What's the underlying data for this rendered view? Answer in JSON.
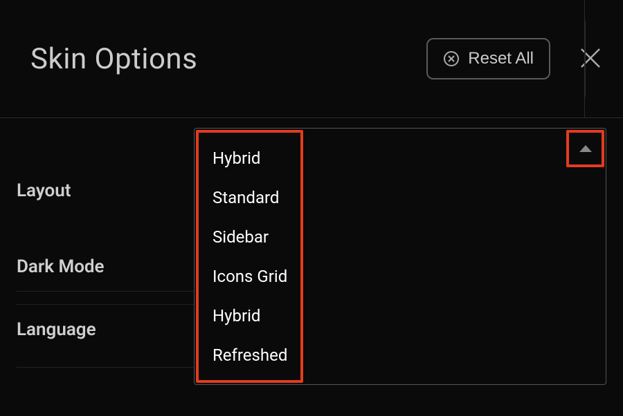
{
  "header": {
    "title": "Skin Options",
    "reset_label": "Reset All"
  },
  "rows": {
    "layout_label": "Layout",
    "darkmode_label": "Dark Mode",
    "language_label": "Language"
  },
  "dropdown": {
    "selected": "Hybrid",
    "options": {
      "opt1": "Standard",
      "opt2": "Sidebar",
      "opt3": "Icons Grid",
      "opt4": "Hybrid",
      "opt5": "Refreshed"
    }
  },
  "colors": {
    "highlight": "#e43b1f",
    "background": "#0a0a0a",
    "text": "#cccccc"
  }
}
